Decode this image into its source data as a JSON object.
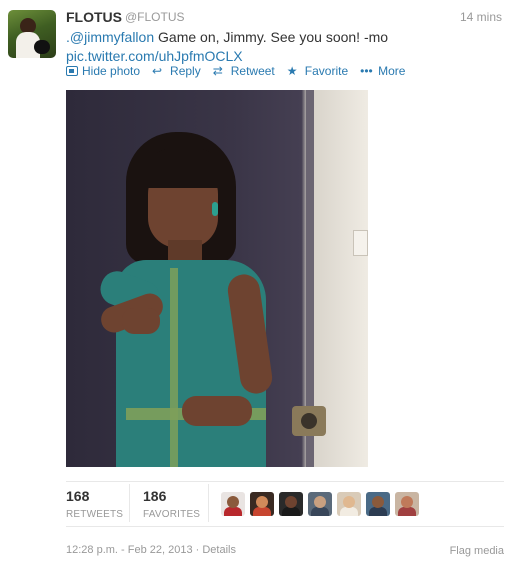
{
  "tweet": {
    "display_name": "FLOTUS",
    "handle": "@FLOTUS",
    "timestamp_relative": "14 mins",
    "text": {
      "mention": ".@jimmyfallon",
      "body": " Game on, Jimmy. See you soon! -mo",
      "link": "pic.twitter.com/uhJpfmOCLX"
    },
    "actions": [
      {
        "label": "Hide photo",
        "icon": "photo-icon"
      },
      {
        "label": "Reply",
        "icon": "reply-icon"
      },
      {
        "label": "Retweet",
        "icon": "retweet-icon"
      },
      {
        "label": "Favorite",
        "icon": "star-icon"
      },
      {
        "label": "More",
        "icon": "more-icon"
      }
    ],
    "stats": {
      "retweets_count": "168",
      "retweets_label": "RETWEETS",
      "favorites_count": "186",
      "favorites_label": "FAVORITES"
    },
    "favoriters": [
      {
        "bg": "#e9e4e2",
        "skin": "#8a5a3c",
        "shirt": "#b8282c"
      },
      {
        "bg": "#3a2a22",
        "skin": "#d08a5a",
        "shirt": "#c7452f"
      },
      {
        "bg": "#2a2a2a",
        "skin": "#6e4330",
        "shirt": "#1a1a1a"
      },
      {
        "bg": "#5b6a7a",
        "skin": "#c9a080",
        "shirt": "#38465a"
      },
      {
        "bg": "#d9cbb8",
        "skin": "#e0b890",
        "shirt": "#f2ece2"
      },
      {
        "bg": "#4a6a86",
        "skin": "#8a5a3c",
        "shirt": "#2c3c52"
      },
      {
        "bg": "#c9b5a2",
        "skin": "#c07a5a",
        "shirt": "#a04040"
      }
    ],
    "meta": "12:28 p.m. - Feb 22, 2013 · Details",
    "flag_label": "Flag media"
  }
}
